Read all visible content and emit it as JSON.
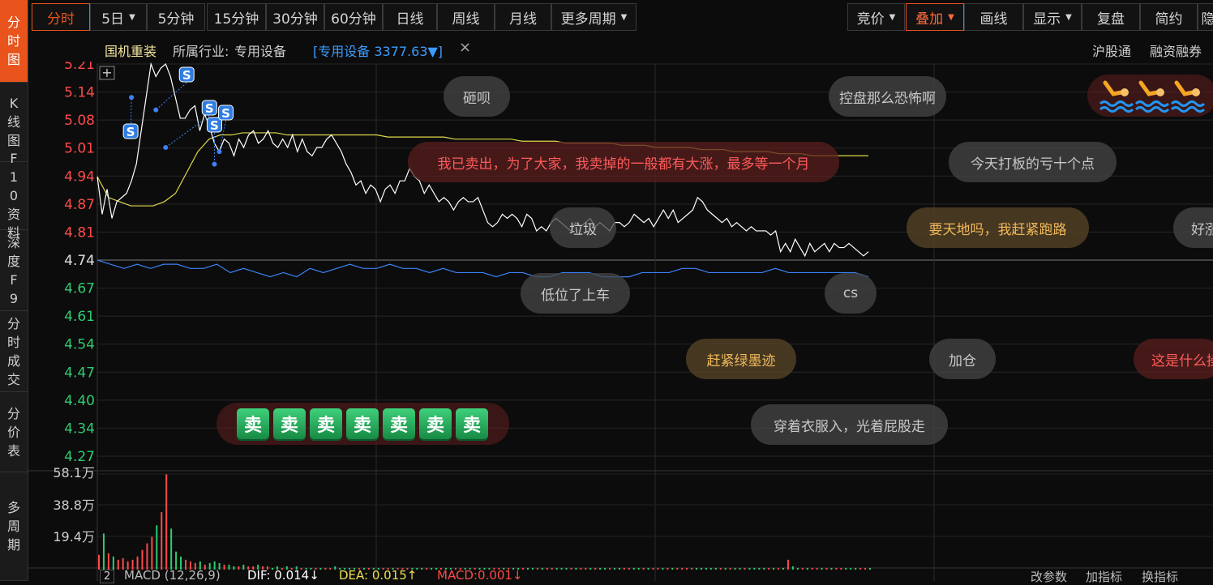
{
  "left_tabs": [
    {
      "label": "分时图",
      "active": true
    },
    {
      "label": "K线图",
      "active": false
    },
    {
      "label": "F10资料",
      "active": false
    },
    {
      "label": "深度F9",
      "active": false
    },
    {
      "label": "分时成交",
      "active": false
    },
    {
      "label": "分价表",
      "active": false
    },
    {
      "label": "多周期",
      "active": false
    }
  ],
  "toolbar_left": [
    "分时",
    "5日",
    "5分钟",
    "15分钟",
    "30分钟",
    "60分钟",
    "日线",
    "周线",
    "月线",
    "更多周期"
  ],
  "toolbar_right": [
    "竞价",
    "叠加",
    "画线",
    "显示",
    "复盘",
    "简约",
    "隐"
  ],
  "info": {
    "stock_name": "国机重装",
    "industry_label": "所属行业:",
    "industry": "专用设备",
    "index_tag": "[专用设备 3377.63▼]",
    "close_mark": "×",
    "link1": "沪股通",
    "link2": "融资融券"
  },
  "price_axis": [
    "5.21",
    "5.14",
    "5.08",
    "5.01",
    "4.94",
    "4.87",
    "4.81",
    "4.74",
    "4.67",
    "4.61",
    "4.54",
    "4.47",
    "4.40",
    "4.34",
    "4.27"
  ],
  "volume_axis": [
    "58.1万",
    "38.8万",
    "19.4万"
  ],
  "sell_markers": [
    "S",
    "S",
    "S",
    "S",
    "S"
  ],
  "danmaku": [
    {
      "text": "砸呗",
      "style": "gray"
    },
    {
      "text": "控盘那么恐怖啊",
      "style": "gray"
    },
    {
      "text": "我已卖出，为了大家，我卖掉的一般都有大涨，最多等一个月",
      "style": "red"
    },
    {
      "text": "今天打板的亏十个点",
      "style": "gray"
    },
    {
      "text": "垃圾",
      "style": "gray"
    },
    {
      "text": "要天地吗，我赶紧跑路",
      "style": "gold"
    },
    {
      "text": "好涨",
      "style": "gray"
    },
    {
      "text": "低位了上车",
      "style": "gray"
    },
    {
      "text": "cs",
      "style": "gray"
    },
    {
      "text": "赶紧绿墨迹",
      "style": "gold"
    },
    {
      "text": "加仓",
      "style": "gray"
    },
    {
      "text": "这是什么操作",
      "style": "red"
    },
    {
      "text": "穿着衣服入，光着屁股走",
      "style": "gray"
    }
  ],
  "sell_stickers": [
    "卖",
    "卖",
    "卖",
    "卖",
    "卖",
    "卖",
    "卖"
  ],
  "indicator": {
    "num": "2",
    "name": "MACD (12,26,9)",
    "dif": "DIF: 0.014↓",
    "dea": "DEA: 0.015↑",
    "macd": "MACD:0.001↓",
    "btn1": "改参数",
    "btn2": "加指标",
    "btn3": "换指标"
  },
  "chart_data": {
    "type": "line",
    "y_range": [
      4.27,
      5.21
    ],
    "price": [
      4.94,
      4.85,
      4.91,
      4.84,
      4.88,
      4.89,
      4.9,
      4.93,
      4.97,
      5.05,
      5.13,
      5.21,
      5.18,
      5.2,
      5.21,
      5.18,
      5.13,
      5.08,
      5.08,
      5.1,
      5.11,
      5.05,
      5.09,
      5.06,
      5.02,
      5.0,
      5.03,
      5.02,
      4.99,
      5.03,
      5.01,
      5.04,
      5.05,
      5.02,
      5.03,
      5.05,
      5.02,
      5.01,
      5.03,
      5.01,
      5.04,
      5.0,
      5.03,
      5.0,
      4.99,
      5.01,
      5.01,
      5.03,
      5.04,
      5.02,
      5.0,
      4.97,
      4.95,
      4.92,
      4.93,
      4.9,
      4.92,
      4.91,
      4.88,
      4.91,
      4.92,
      4.9,
      4.93,
      4.93,
      4.96,
      4.94,
      4.93,
      4.9,
      4.92,
      4.9,
      4.88,
      4.89,
      4.88,
      4.86,
      4.88,
      4.89,
      4.88,
      4.88,
      4.89,
      4.86,
      4.83,
      4.82,
      4.83,
      4.85,
      4.84,
      4.85,
      4.84,
      4.82,
      4.85,
      4.84,
      4.81,
      4.82,
      4.81,
      4.83,
      4.84,
      4.83,
      4.82,
      4.81,
      4.83,
      4.82,
      4.83,
      4.84,
      4.82,
      4.83,
      4.82,
      4.81,
      4.83,
      4.83,
      4.82,
      4.83,
      4.85,
      4.84,
      4.83,
      4.84,
      4.82,
      4.84,
      4.86,
      4.84,
      4.86,
      4.83,
      4.84,
      4.85,
      4.86,
      4.89,
      4.88,
      4.86,
      4.85,
      4.84,
      4.83,
      4.84,
      4.82,
      4.83,
      4.82,
      4.81,
      4.82,
      4.81,
      4.81,
      4.81,
      4.8,
      4.81,
      4.76,
      4.78,
      4.76,
      4.79,
      4.77,
      4.75,
      4.78,
      4.76,
      4.77,
      4.78,
      4.76,
      4.78,
      4.77,
      4.77,
      4.78,
      4.77,
      4.76,
      4.75,
      4.76
    ],
    "avg": [
      4.94,
      4.89,
      4.88,
      4.87,
      4.87,
      4.87,
      4.88,
      4.9,
      4.95,
      5.0,
      5.03,
      5.04,
      5.04,
      5.045,
      5.045,
      5.045,
      5.045,
      5.04,
      5.04,
      5.04,
      5.04,
      5.04,
      5.04,
      5.04,
      5.04,
      5.04,
      5.035,
      5.035,
      5.035,
      5.035,
      5.035,
      5.035,
      5.03,
      5.03,
      5.03,
      5.03,
      5.03,
      5.03,
      5.025,
      5.025,
      5.025,
      5.025,
      5.02,
      5.02,
      5.02,
      5.02,
      5.02,
      5.015,
      5.015,
      5.015,
      5.01,
      5.01,
      5.01,
      5.01,
      5.005,
      5.005,
      5.005,
      5.0,
      5.0,
      5.0,
      5.0,
      4.995,
      4.995,
      4.995,
      4.99,
      4.99,
      4.99,
      4.99,
      4.99,
      4.99
    ],
    "index_overlay": [
      4.74,
      4.73,
      4.72,
      4.73,
      4.72,
      4.73,
      4.73,
      4.72,
      4.72,
      4.73,
      4.71,
      4.72,
      4.71,
      4.7,
      4.71,
      4.7,
      4.72,
      4.71,
      4.72,
      4.73,
      4.72,
      4.72,
      4.73,
      4.72,
      4.72,
      4.71,
      4.72,
      4.71,
      4.71,
      4.71,
      4.7,
      4.71,
      4.71,
      4.7,
      4.7,
      4.71,
      4.71,
      4.71,
      4.7,
      4.7,
      4.7,
      4.71,
      4.71,
      4.71,
      4.72,
      4.72,
      4.71,
      4.71,
      4.71,
      4.71,
      4.71,
      4.72,
      4.71,
      4.71,
      4.71,
      4.71,
      4.71,
      4.71,
      4.7
    ],
    "sell_marks": [
      {
        "i": 7,
        "price": 5.13
      },
      {
        "i": 12,
        "price": 5.1
      },
      {
        "i": 14,
        "price": 5.01
      },
      {
        "i": 24,
        "price": 4.97
      },
      {
        "i": 25,
        "price": 5.0
      }
    ],
    "volume_max": 58.1,
    "volume": [
      9,
      22,
      10,
      8,
      6,
      7,
      5,
      6,
      8,
      12,
      16,
      20,
      27,
      35,
      58.1,
      25,
      11,
      8,
      6,
      5,
      4,
      5,
      3,
      4,
      5,
      4,
      3,
      3,
      2,
      2,
      3,
      2,
      2,
      3,
      2,
      2,
      1,
      2,
      1,
      2,
      1,
      2,
      1,
      1,
      1,
      1,
      1,
      1,
      1,
      2,
      1,
      1,
      1,
      1,
      1,
      1,
      1,
      1,
      1,
      1,
      1,
      1,
      1,
      1,
      1,
      1,
      1,
      1,
      1,
      1,
      1,
      1,
      1,
      1,
      1,
      1,
      1,
      1,
      1,
      1,
      1,
      1,
      1,
      1,
      1,
      1,
      1,
      1,
      1,
      1,
      1,
      1,
      1,
      1,
      1,
      1,
      1,
      1,
      1,
      1,
      1,
      1,
      1,
      1,
      1,
      1,
      1,
      1,
      1,
      1,
      1,
      1,
      1,
      1,
      1,
      1,
      1,
      1,
      1,
      1,
      1,
      1,
      1,
      1,
      1,
      1,
      1,
      1,
      1,
      1,
      1,
      1,
      1,
      1,
      1,
      1,
      1,
      1,
      1,
      1,
      1,
      1,
      1,
      6,
      2,
      1,
      1,
      1,
      1,
      1,
      1,
      1,
      1,
      1,
      1,
      1,
      1,
      1,
      1,
      1,
      1
    ]
  },
  "colors": {
    "accent": "#e8541c",
    "price_line": "#ffffff",
    "avg_line": "#e0d84a",
    "index_line": "#3b82f6",
    "up": "#ff4a4a",
    "down": "#2ecc71",
    "flat": "#d0d0d0"
  }
}
